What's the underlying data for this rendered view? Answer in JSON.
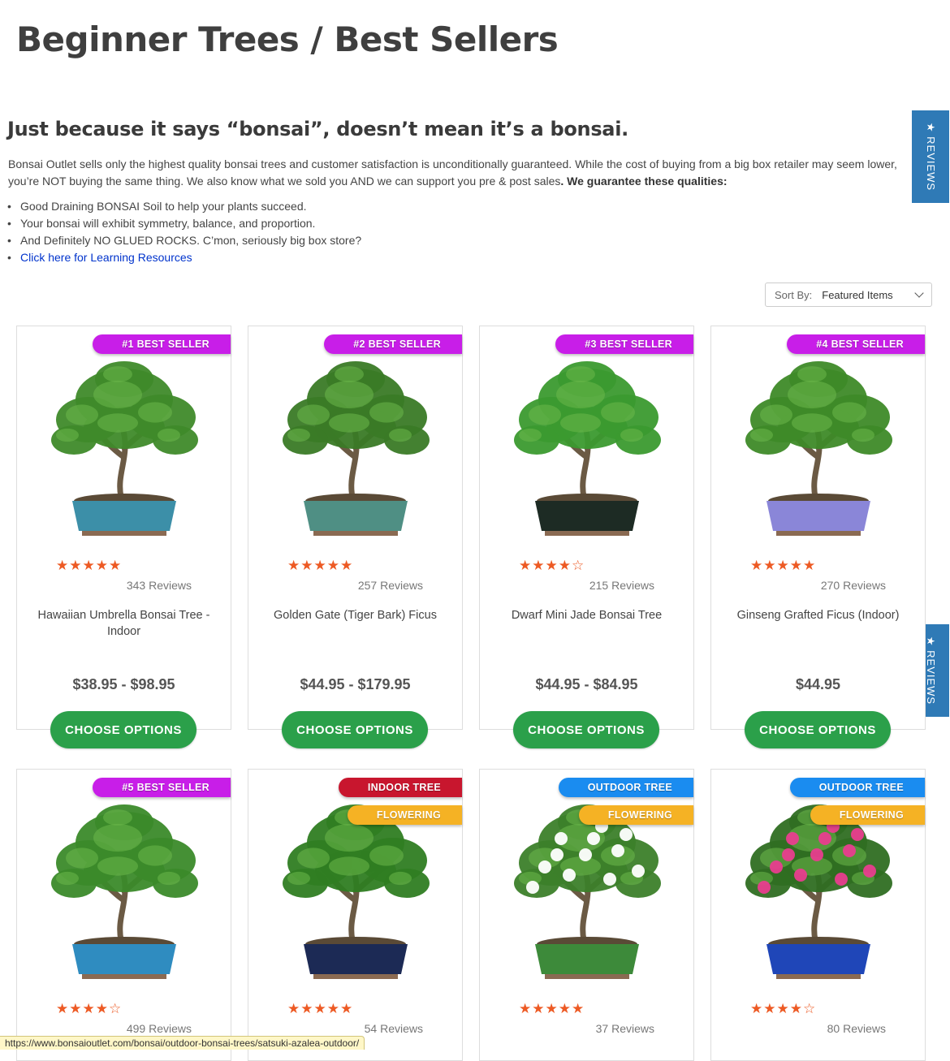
{
  "page_title": "Beginner Trees / Best Sellers",
  "intro": {
    "heading": "Just because it says “bonsai”, doesn’t mean it’s a bonsai.",
    "text": "Bonsai Outlet sells only the highest quality bonsai trees and customer satisfaction is unconditionally guaranteed. While the cost of buying from a big box retailer may seem lower, you’re NOT buying the same thing. We also know what we sold you AND we can support you pre & post sales",
    "text_bold": ". We guarantee these qualities:",
    "bullets": [
      "Good Draining BONSAI Soil to help your plants succeed.",
      "Your bonsai will exhibit symmetry, balance, and proportion.",
      "And Definitely NO GLUED ROCKS. C’mon, seriously big box store?"
    ],
    "link": "Click here for Learning Resources"
  },
  "reviews_tab": {
    "label": "★ REVIEWS"
  },
  "sort": {
    "label": "Sort By:",
    "value": "Featured Items"
  },
  "products": [
    {
      "badges": [
        {
          "text": "#1 BEST SELLER",
          "color": "#c81ee8"
        }
      ],
      "stars": "★★★★★",
      "reviews": "343 Reviews",
      "name": "Hawaiian Umbrella Bonsai Tree - Indoor",
      "price": "$38.95 - $98.95",
      "button": "CHOOSE OPTIONS",
      "pot_color": "#3c8fa8",
      "foliage": "#3f8a2a"
    },
    {
      "badges": [
        {
          "text": "#2 BEST SELLER",
          "color": "#c81ee8"
        }
      ],
      "stars": "★★★★★",
      "reviews": "257 Reviews",
      "name": "Golden Gate (Tiger Bark) Ficus",
      "price": "$44.95 - $179.95",
      "button": "CHOOSE OPTIONS",
      "pot_color": "#4f8f84",
      "foliage": "#3a7a26"
    },
    {
      "badges": [
        {
          "text": "#3 BEST SELLER",
          "color": "#c81ee8"
        }
      ],
      "stars": "★★★★☆",
      "reviews": "215 Reviews",
      "name": "Dwarf Mini Jade Bonsai Tree",
      "price": "$44.95 - $84.95",
      "button": "CHOOSE OPTIONS",
      "pot_color": "#1d2b24",
      "foliage": "#3b9a2f"
    },
    {
      "badges": [
        {
          "text": "#4 BEST SELLER",
          "color": "#c81ee8"
        }
      ],
      "stars": "★★★★★",
      "reviews": "270 Reviews",
      "name": "Ginseng Grafted Ficus (Indoor)",
      "price": "$44.95",
      "button": "CHOOSE OPTIONS",
      "pot_color": "#8a86d8",
      "foliage": "#3e8a28"
    },
    {
      "badges": [
        {
          "text": "#5 BEST SELLER",
          "color": "#c81ee8"
        }
      ],
      "stars": "★★★★☆",
      "reviews": "499 Reviews",
      "name": "",
      "price": "",
      "button": "",
      "pot_color": "#2f8cc0",
      "foliage": "#3b8a2a"
    },
    {
      "badges": [
        {
          "text": "INDOOR TREE",
          "color": "#c8162e"
        },
        {
          "text": "FLOWERING",
          "color": "#f5b224"
        }
      ],
      "stars": "★★★★★",
      "reviews": "54 Reviews",
      "name": "",
      "price": "",
      "button": "",
      "pot_color": "#1c2a55",
      "foliage": "#2f7d22"
    },
    {
      "badges": [
        {
          "text": "OUTDOOR TREE",
          "color": "#1a8cf0"
        },
        {
          "text": "FLOWERING",
          "color": "#f5b224"
        }
      ],
      "stars": "★★★★★",
      "reviews": "37 Reviews",
      "name": "",
      "price": "",
      "button": "",
      "pot_color": "#3d8a3a",
      "foliage": "#3c7f2a",
      "flowers": "#ffffff"
    },
    {
      "badges": [
        {
          "text": "OUTDOOR TREE",
          "color": "#1a8cf0"
        },
        {
          "text": "FLOWERING",
          "color": "#f5b224"
        }
      ],
      "stars": "★★★★☆",
      "reviews": "80 Reviews",
      "name": "",
      "price": "",
      "button": "",
      "pot_color": "#1f46b8",
      "foliage": "#2f6e22",
      "flowers": "#e83d8e"
    }
  ],
  "status_url": "https://www.bonsaioutlet.com/bonsai/outdoor-bonsai-trees/satsuki-azalea-outdoor/"
}
